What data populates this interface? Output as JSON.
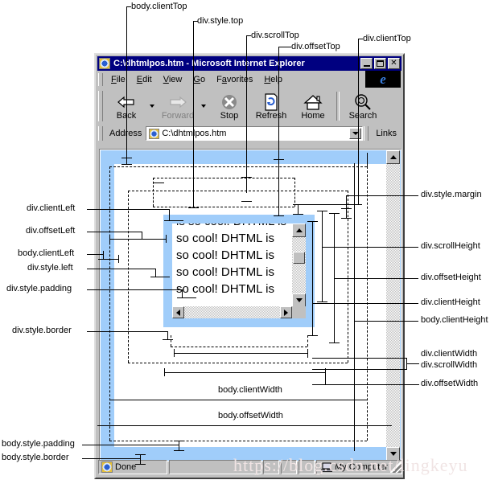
{
  "browser": {
    "title": "C:\\dhtmlpos.htm - Microsoft Internet Explorer",
    "window_controls": {
      "minimize": "_",
      "maximize": "□",
      "close": "×"
    },
    "menu": [
      {
        "label": "File",
        "accel": "F"
      },
      {
        "label": "Edit",
        "accel": "E"
      },
      {
        "label": "View",
        "accel": "V"
      },
      {
        "label": "Go",
        "accel": "G"
      },
      {
        "label": "Favorites",
        "accel": "a"
      },
      {
        "label": "Help",
        "accel": "H"
      }
    ],
    "toolbar": [
      {
        "label": "Back",
        "icon": "back-arrow-icon",
        "disabled": false,
        "dropdown": true
      },
      {
        "label": "Forward",
        "icon": "forward-arrow-icon",
        "disabled": true,
        "dropdown": true
      },
      {
        "label": "Stop",
        "icon": "stop-icon",
        "disabled": false,
        "dropdown": false
      },
      {
        "label": "Refresh",
        "icon": "refresh-icon",
        "disabled": false,
        "dropdown": false
      },
      {
        "label": "Home",
        "icon": "home-icon",
        "disabled": false,
        "dropdown": false
      },
      {
        "label": "Search",
        "icon": "search-icon",
        "disabled": false,
        "dropdown": false
      }
    ],
    "address": {
      "label": "Address",
      "value": "C:\\dhtmlpos.htm",
      "placeholder": "C:\\dhtmlpos.htm",
      "links_label": "Links"
    },
    "status": {
      "text": "Done",
      "zone": "My Computer"
    }
  },
  "page": {
    "div_text": "is so cool! DHTML is so cool! DHTML is so cool! DHTML is so cool! DHTML is so cool! DHTML is"
  },
  "labels": {
    "top": [
      {
        "id": "body-clientTop",
        "text": "body.clientTop"
      },
      {
        "id": "div-style-top",
        "text": "div.style.top"
      },
      {
        "id": "div-scrollTop",
        "text": "div.scrollTop"
      },
      {
        "id": "div-offsetTop",
        "text": "div.offsetTop"
      },
      {
        "id": "div-clientTop",
        "text": "div.clientTop"
      }
    ],
    "left": [
      {
        "id": "div-clientLeft",
        "text": "div.clientLeft"
      },
      {
        "id": "div-offsetLeft",
        "text": "div.offsetLeft"
      },
      {
        "id": "body-clientLeft",
        "text": "body.clientLeft"
      },
      {
        "id": "div-style-left",
        "text": "div.style.left"
      },
      {
        "id": "div-style-padding",
        "text": "div.style.padding"
      },
      {
        "id": "div-style-border",
        "text": "div.style.border"
      },
      {
        "id": "body-style-padding",
        "text": "body.style.padding"
      },
      {
        "id": "body-style-border",
        "text": "body.style.border"
      }
    ],
    "right": [
      {
        "id": "div-style-margin",
        "text": "div.style.margin"
      },
      {
        "id": "div-scrollHeight",
        "text": "div.scrollHeight"
      },
      {
        "id": "div-offsetHeight",
        "text": "div.offsetHeight"
      },
      {
        "id": "div-clientHeight",
        "text": "div.clientHeight"
      },
      {
        "id": "body-clientHeight",
        "text": "body.clientHeight"
      },
      {
        "id": "div-clientWidth",
        "text": "div.clientWidth"
      },
      {
        "id": "div-scrollWidth",
        "text": "div.scrollWidth"
      },
      {
        "id": "div-offsetWidth",
        "text": "div.offsetWidth"
      }
    ],
    "inline": [
      {
        "id": "body-clientWidth",
        "text": "body.clientWidth"
      },
      {
        "id": "body-offsetWidth",
        "text": "body.offsetWidth"
      }
    ]
  },
  "watermark": {
    "text": "https://blog.csdn.net/lingkeyu"
  },
  "colors": {
    "titlebar": "#000080",
    "chrome": "#c0c0c0",
    "body_margin_blue": "#a0cdfa",
    "page_white": "#ffffff",
    "line": "#000000"
  }
}
